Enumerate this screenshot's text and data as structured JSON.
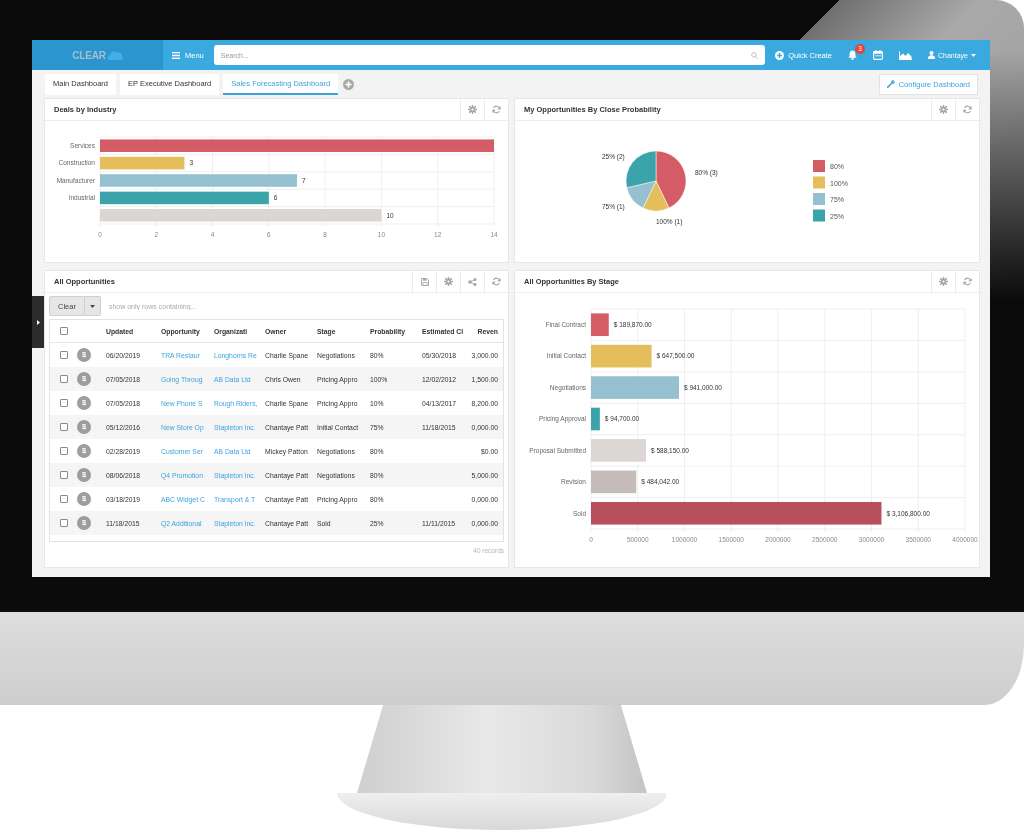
{
  "nav": {
    "logo": "CLEAR",
    "menu_label": "Menu",
    "search": {
      "placeholder": "Search..."
    },
    "quick_create": "Quick Create",
    "notification_count": "3",
    "user": "Chantaye"
  },
  "tabs": [
    {
      "label": "Main Dashboard",
      "selected": false
    },
    {
      "label": "EP Executive Dashboard",
      "selected": false
    },
    {
      "label": "Sales Forecasting Dashboard",
      "selected": true
    }
  ],
  "configure_button": "Configure Dashboard",
  "panels": [
    {
      "kind": "chart",
      "title": "Deals by Industry",
      "chart_data": {
        "type": "bar",
        "orientation": "horizontal",
        "grid": true,
        "categories": [
          "Services",
          "Construction",
          "Manufacturer",
          "Industrial",
          null
        ],
        "series": [
          {
            "values": [
              14,
              3,
              7,
              6,
              10
            ]
          }
        ],
        "colors": [
          "#d45c66",
          "#e3be5a",
          "#94c0cf",
          "#3ba4aa",
          "#dbd6d3"
        ],
        "value_labels": [
          null,
          "3",
          "7",
          "6",
          "10"
        ],
        "xlim": [
          0,
          14
        ],
        "xticks": [
          0,
          2,
          4,
          6,
          8,
          10,
          12,
          14
        ]
      }
    },
    {
      "kind": "chart",
      "title": "My Opportunities By Close Probability",
      "chart_data": {
        "type": "pie",
        "legend": "right",
        "categories": [
          "80%",
          "100%",
          "75%",
          "25%"
        ],
        "values": [
          3,
          1,
          1,
          2
        ],
        "colors": [
          "#d45c66",
          "#e3be5a",
          "#94c0cf",
          "#3ba4aa"
        ],
        "value_labels": [
          "80% (3)",
          "100% (1)",
          "75% (1)",
          "25% (2)"
        ]
      }
    },
    {
      "kind": "table",
      "title": "All Opportunities",
      "filter": {
        "button": "Clear",
        "placeholder": "show only rows containing..."
      },
      "columns": [
        {
          "label": "Updated",
          "kind": "text"
        },
        {
          "label": "Opportunity",
          "kind": "link"
        },
        {
          "label": "Organizati",
          "kind": "link"
        },
        {
          "label": "Owner",
          "kind": "text"
        },
        {
          "label": "Stage",
          "kind": "text"
        },
        {
          "label": "Probability",
          "kind": "text"
        },
        {
          "label": "Estimated Cl",
          "kind": "text"
        },
        {
          "label": "Reven",
          "kind": "number"
        }
      ],
      "header_checked": false,
      "rows": [
        {
          "checked": false,
          "badge": "$",
          "cells": [
            "06/20/2019",
            "TRA Restaur",
            "Longhorns Re",
            "Charlie Spane",
            "Negotiations",
            "80%",
            "05/30/2018",
            "3,000.00"
          ]
        },
        {
          "checked": false,
          "badge": "$",
          "cells": [
            "07/05/2018",
            "Going Throug",
            "AB Data Ltd",
            "Chris Owen",
            "Pricing Appro",
            "100%",
            "12/02/2012",
            "1,500.00"
          ]
        },
        {
          "checked": false,
          "badge": "$",
          "cells": [
            "07/05/2018",
            "New Phone S",
            "Rough Riders,",
            "Charlie Spane",
            "Pricing Appro",
            "10%",
            "04/13/2017",
            "8,200.00"
          ]
        },
        {
          "checked": false,
          "badge": "$",
          "cells": [
            "05/12/2016",
            "New Store Op",
            "Stapleton Inc.",
            "Chantaye Patt",
            "Initial Contact",
            "75%",
            "11/18/2015",
            "0,000.00"
          ]
        },
        {
          "checked": false,
          "badge": "$",
          "cells": [
            "02/28/2019",
            "Customer Ser",
            "AB Data Ltd",
            "Mickey Patton",
            "Negotiations",
            "80%",
            null,
            "$0.00"
          ]
        },
        {
          "checked": false,
          "badge": "$",
          "cells": [
            "08/06/2018",
            "Q4 Promotion",
            "Stapleton Inc.",
            "Chantaye Patt",
            "Negotiations",
            "80%",
            null,
            "5,000.00"
          ]
        },
        {
          "checked": false,
          "badge": "$",
          "cells": [
            "03/18/2019",
            "ABC Widget C",
            "Transport & T",
            "Chantaye Patt",
            "Pricing Appro",
            "80%",
            null,
            "0,000.00"
          ]
        },
        {
          "checked": false,
          "badge": "$",
          "cells": [
            "11/18/2015",
            "Q2 Additional",
            "Stapleton Inc.",
            "Chantaye Patt",
            "Sold",
            "25%",
            "11/11/2015",
            "0,000.00"
          ]
        }
      ],
      "footer": "40 records"
    },
    {
      "kind": "chart",
      "title": "All Opportunities By Stage",
      "chart_data": {
        "type": "bar",
        "orientation": "horizontal",
        "grid": true,
        "categories": [
          "Final Contract",
          "Initial Contact",
          "Negotiations",
          "Pricing Approval",
          "Proposal Submitted",
          "Revision",
          "Sold"
        ],
        "series": [
          {
            "values": [
              189870,
              647500,
              941000,
              94700,
              588150,
              484042,
              3106800
            ]
          }
        ],
        "colors": [
          "#d45c66",
          "#e3be5a",
          "#94c0cf",
          "#3ba4aa",
          "#dcd7d4",
          "#c5bbb9",
          "#b8505b"
        ],
        "value_labels": [
          "$ 189,870.00",
          "$ 647,500.00",
          "$ 941,000.00",
          "$ 94,700.00",
          "$ 588,150.00",
          "$ 484,042.00",
          "$ 3,106,800.00"
        ],
        "xlim": [
          0,
          4000000
        ],
        "xticks": [
          0,
          500000,
          1000000,
          1500000,
          2000000,
          2500000,
          3000000,
          3500000,
          4000000
        ]
      }
    }
  ]
}
